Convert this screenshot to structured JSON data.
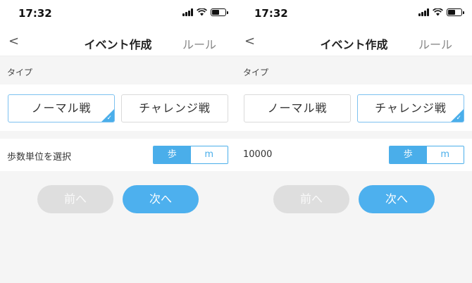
{
  "screens": [
    {
      "status_time": "17:32",
      "nav": {
        "back": "<",
        "title": "イベント作成",
        "rule": "ルール"
      },
      "type_label": "タイプ",
      "type_options": [
        "ノーマル戦",
        "チャレンジ戦"
      ],
      "selected_type": 0,
      "row_label": "歩数単位を選択",
      "unit_options": [
        "歩",
        "m"
      ],
      "selected_unit": 0,
      "prev_label": "前へ",
      "next_label": "次へ"
    },
    {
      "status_time": "17:32",
      "nav": {
        "back": "<",
        "title": "イベント作成",
        "rule": "ルール"
      },
      "type_label": "タイプ",
      "type_options": [
        "ノーマル戦",
        "チャレンジ戦"
      ],
      "selected_type": 1,
      "row_label": "10000",
      "unit_options": [
        "歩",
        "m"
      ],
      "selected_unit": 0,
      "prev_label": "前へ",
      "next_label": "次へ"
    }
  ],
  "colors": {
    "accent": "#4aaeea",
    "disabled": "#dedede",
    "background": "#f5f5f5"
  },
  "icons": [
    "signal-icon",
    "wifi-icon",
    "battery-icon",
    "back-chevron-icon",
    "checkmark-icon"
  ]
}
